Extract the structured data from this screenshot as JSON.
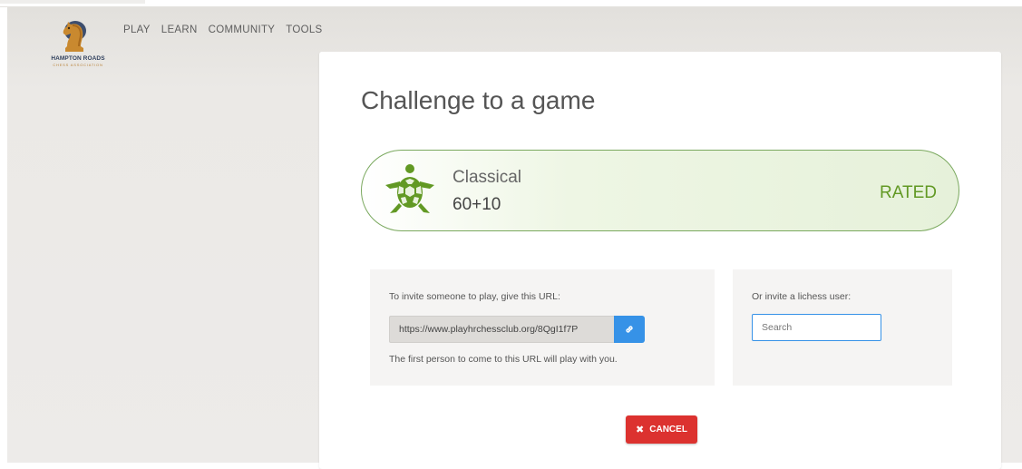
{
  "site": {
    "logo_title": "HAMPTON ROADS",
    "logo_subtitle": "CHESS ASSOCIATION"
  },
  "nav": {
    "items": [
      {
        "label": "PLAY"
      },
      {
        "label": "LEARN"
      },
      {
        "label": "COMMUNITY"
      },
      {
        "label": "TOOLS"
      }
    ]
  },
  "challenge": {
    "heading": "Challenge to a game",
    "variant": {
      "icon": "turtle-icon",
      "name": "Classical",
      "time_control": "60+10",
      "mode": "RATED",
      "accent_color": "#629924"
    },
    "invite_url": {
      "label": "To invite someone to play, give this URL:",
      "url": "https://www.playhrchessclub.org/8QgI1f7P",
      "copy_icon": "link-icon",
      "note": "The first person to come to this URL will play with you."
    },
    "invite_user": {
      "label": "Or invite a lichess user:",
      "placeholder": "Search",
      "value": ""
    },
    "cancel": {
      "icon": "✖",
      "label": "CANCEL",
      "color": "#dc322f"
    }
  }
}
